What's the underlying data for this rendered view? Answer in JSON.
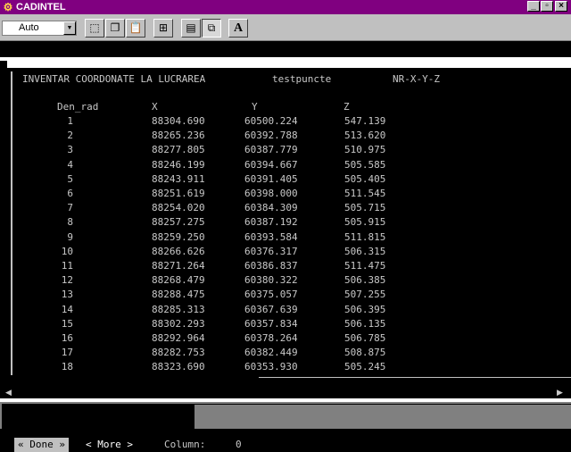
{
  "window": {
    "title": "CADINTEL"
  },
  "toolbar": {
    "combo_value": "Auto",
    "buttons": [
      {
        "name": "select-icon",
        "glyph": "⬚"
      },
      {
        "name": "copy-icon",
        "glyph": "❐"
      },
      {
        "name": "paste-icon",
        "glyph": "📋"
      },
      {
        "name": "fullscreen-icon",
        "glyph": "⊞"
      },
      {
        "name": "properties-icon",
        "glyph": "▤"
      },
      {
        "name": "background-icon",
        "glyph": "⧉"
      },
      {
        "name": "font-icon",
        "glyph": "A"
      }
    ]
  },
  "report": {
    "heading": "INVENTAR COORDONATE LA LUCRAREA",
    "project": "testpuncte",
    "format": "NR-X-Y-Z",
    "columns": [
      "Den_rad",
      "X",
      "Y",
      "Z"
    ],
    "rows": [
      [
        "1",
        "88304.690",
        "60500.224",
        "547.139"
      ],
      [
        "2",
        "88265.236",
        "60392.788",
        "513.620"
      ],
      [
        "3",
        "88277.805",
        "60387.779",
        "510.975"
      ],
      [
        "4",
        "88246.199",
        "60394.667",
        "505.585"
      ],
      [
        "5",
        "88243.911",
        "60391.405",
        "505.405"
      ],
      [
        "6",
        "88251.619",
        "60398.000",
        "511.545"
      ],
      [
        "7",
        "88254.020",
        "60384.309",
        "505.715"
      ],
      [
        "8",
        "88257.275",
        "60387.192",
        "505.915"
      ],
      [
        "9",
        "88259.250",
        "60393.584",
        "511.815"
      ],
      [
        "10",
        "88266.626",
        "60376.317",
        "506.315"
      ],
      [
        "11",
        "88271.264",
        "60386.837",
        "511.475"
      ],
      [
        "12",
        "88268.479",
        "60380.322",
        "506.385"
      ],
      [
        "13",
        "88288.475",
        "60375.057",
        "507.255"
      ],
      [
        "14",
        "88285.313",
        "60367.639",
        "506.395"
      ],
      [
        "15",
        "88302.293",
        "60357.834",
        "506.135"
      ],
      [
        "16",
        "88292.964",
        "60378.264",
        "506.785"
      ],
      [
        "17",
        "88282.753",
        "60382.449",
        "508.875"
      ],
      [
        "18",
        "88323.690",
        "60353.930",
        "505.245"
      ]
    ]
  },
  "statusbar": {
    "done_label": "« Done »",
    "more_label": "< More >",
    "column_label": "Column:",
    "column_value": "0"
  },
  "colors": {
    "titlebar": "#800080",
    "terminal_bg": "#000000",
    "terminal_text": "#c8c8c8",
    "done_bg": "#c0c0c0"
  }
}
